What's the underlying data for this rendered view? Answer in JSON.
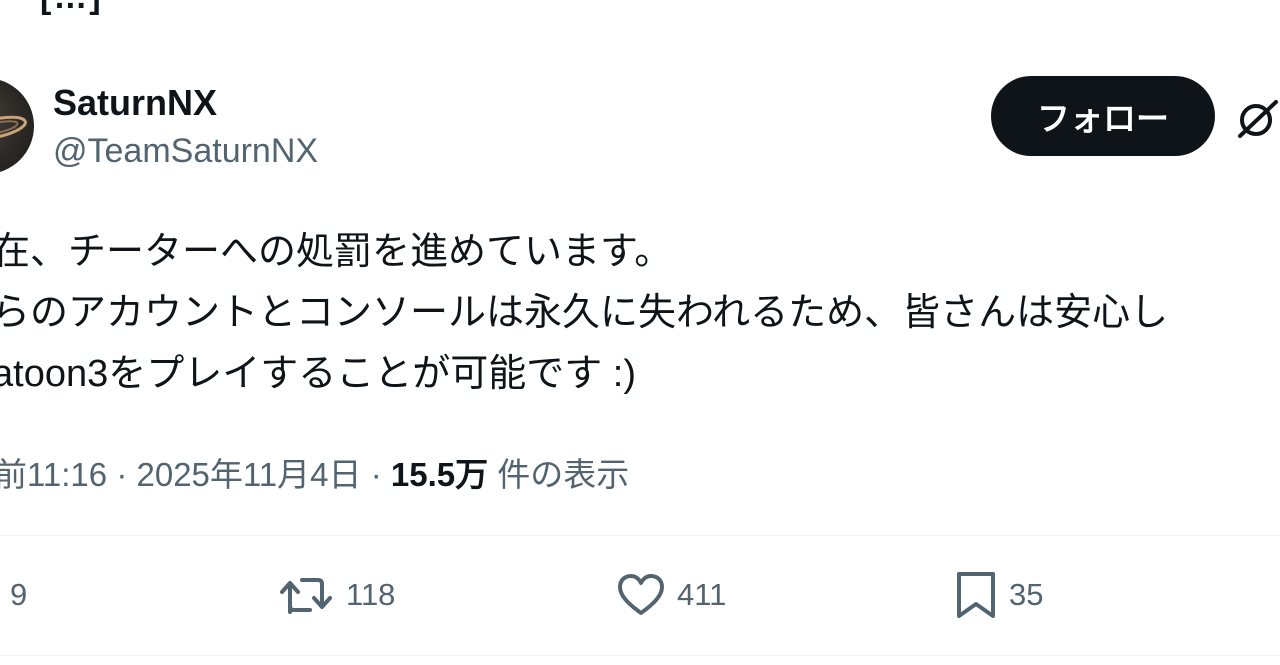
{
  "header_fragment": "[…]",
  "author": {
    "display_name": "SaturnNX",
    "handle": "@TeamSaturnNX"
  },
  "follow_label": "フォロー",
  "tweet": {
    "lines": [
      "在、チーターへの処罰を進めています。",
      "らのアカウントとコンソールは永久に失われるため、皆さんは安心し",
      "atoon3をプレイすることが可能です :)"
    ]
  },
  "meta": {
    "time": "前11:16",
    "separator": "·",
    "date": "2025年11月4日",
    "views_count": "15.5万",
    "views_label": "件の表示"
  },
  "actions": {
    "reply_count": "9",
    "retweet_count": "118",
    "like_count": "411",
    "bookmark_count": "35"
  },
  "colors": {
    "text_primary": "#0f1419",
    "text_secondary": "#536471",
    "follow_bg": "#0f1419",
    "divider": "#eff3f4"
  }
}
